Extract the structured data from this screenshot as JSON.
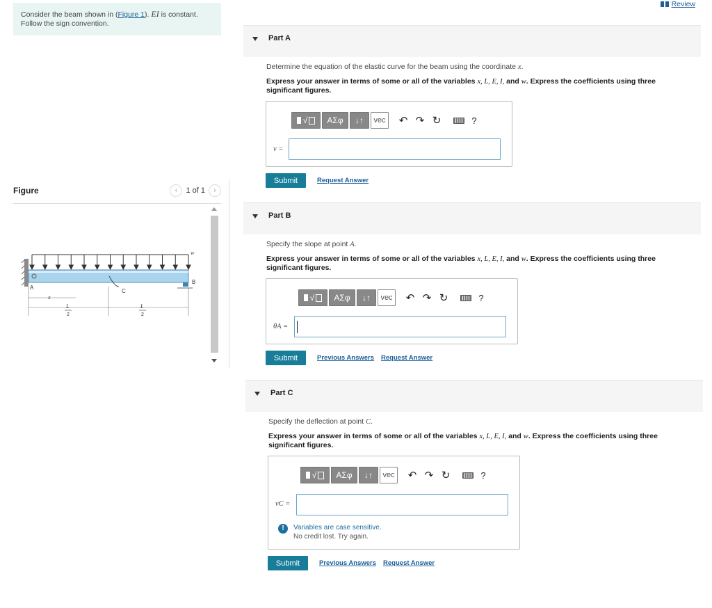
{
  "header": {
    "review_label": "Review"
  },
  "problem": {
    "text_before": "Consider the beam shown in (",
    "figure_link": "Figure 1",
    "text_mid": "). ",
    "ei": "EI",
    "text_after": " is constant. Follow the sign convention."
  },
  "figure": {
    "title": "Figure",
    "pager": "1 of 1",
    "labels": {
      "load": "w",
      "point_a": "A",
      "point_b": "B",
      "point_c": "C",
      "x": "x",
      "l_num": "L",
      "l_den": "2"
    }
  },
  "toolbar": {
    "greek": "ΑΣφ",
    "arrows": "↓↑",
    "vec": "vec",
    "help": "?"
  },
  "parts": [
    {
      "title": "Part A",
      "instruction_prefix": "Determine the equation of the elastic curve for the beam using the coordinate ",
      "instruction_var": "x",
      "instruction_suffix": ".",
      "label": "v =",
      "submit": "Submit",
      "links": [
        "Request Answer"
      ]
    },
    {
      "title": "Part B",
      "instruction_prefix": "Specify the slope at point ",
      "instruction_var": "A",
      "instruction_suffix": ".",
      "label": "θA =",
      "submit": "Submit",
      "links": [
        "Previous Answers",
        "Request Answer"
      ]
    },
    {
      "title": "Part C",
      "instruction_prefix": "Specify the deflection at point ",
      "instruction_var": "C",
      "instruction_suffix": ".",
      "label": "vC =",
      "submit": "Submit",
      "links": [
        "Previous Answers",
        "Request Answer"
      ],
      "warning": {
        "line1": "Variables are case sensitive.",
        "line2": "No credit lost. Try again."
      }
    }
  ],
  "express_text": {
    "prefix": "Express your answer in terms of some or all of the variables ",
    "vars": "x, L, E, I,",
    "and": " and ",
    "last": "w",
    "suffix": ". Express the coefficients using three significant figures."
  }
}
